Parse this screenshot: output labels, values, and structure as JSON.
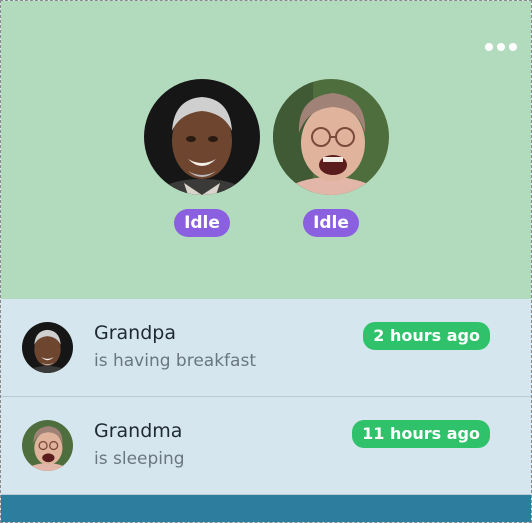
{
  "hero": {
    "more_icon": "more-horizontal-icon",
    "people": [
      {
        "status": "Idle"
      },
      {
        "status": "Idle"
      }
    ]
  },
  "list": [
    {
      "name": "Grandpa",
      "activity": "is having breakfast",
      "time": "2 hours ago"
    },
    {
      "name": "Grandma",
      "activity": "is sleeping",
      "time": "11 hours ago"
    }
  ],
  "colors": {
    "hero_bg": "#b2dbbd",
    "list_bg": "#d6e6ee",
    "status_pill": "#8a5fe0",
    "time_badge": "#2fc26a",
    "footer": "#2d7d9f"
  }
}
